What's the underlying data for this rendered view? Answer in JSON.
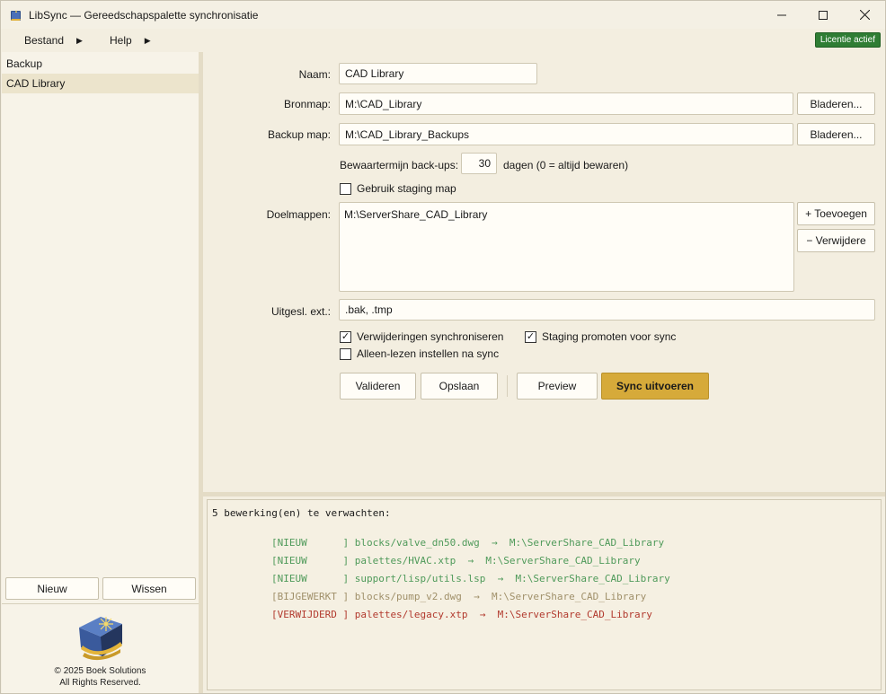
{
  "window": {
    "title": "LibSync — Gereedschapspalette synchronisatie",
    "controls": [
      "minimize",
      "maximize",
      "close"
    ]
  },
  "menu": {
    "items": [
      {
        "label": "Bestand"
      },
      {
        "label": "Help"
      }
    ],
    "license_badge": "Licentie actief"
  },
  "sidebar": {
    "items": [
      {
        "label": "Backup",
        "selected": false
      },
      {
        "label": "CAD Library",
        "selected": true
      }
    ],
    "new_button": "Nieuw",
    "clear_button": "Wissen",
    "copyright_line1": "© 2025 Boek Solutions",
    "copyright_line2": "All Rights Reserved."
  },
  "form": {
    "name_label": "Naam:",
    "name_value": "CAD Library",
    "source_label": "Bronmap:",
    "source_value": "M:\\CAD_Library",
    "source_browse": "Bladeren...",
    "backup_label": "Backup map:",
    "backup_value": "M:\\CAD_Library_Backups",
    "backup_browse": "Bladeren...",
    "retention_label": "Bewaartermijn back-ups:",
    "retention_value": "30",
    "retention_suffix": "dagen (0 = altijd bewaren)",
    "staging_label": "Gebruik staging map",
    "staging_checked": false,
    "targets_label": "Doelmappen:",
    "targets": [
      "M:\\ServerShare_CAD_Library"
    ],
    "add_button": "+ Toevoegen",
    "remove_button": "− Verwijdere",
    "excl_label": "Uitgesl. ext.:",
    "excl_value": ".bak, .tmp",
    "sync_deletes_label": "Verwijderingen synchroniseren",
    "sync_deletes_checked": true,
    "promote_staging_label": "Staging promoten voor sync",
    "promote_staging_checked": true,
    "readonly_label": "Alleen-lezen instellen na sync",
    "readonly_checked": false,
    "validate_button": "Valideren",
    "save_button": "Opslaan",
    "preview_button": "Preview",
    "sync_button": "Sync uitvoeren"
  },
  "log": {
    "header": "5 bewerking(en) te verwachten:",
    "lines": [
      {
        "tag": "[NIEUW      ]",
        "path": "blocks/valve_dn50.dwg",
        "arrow": "→",
        "target": "M:\\ServerShare_CAD_Library",
        "color": "#4f9a5a"
      },
      {
        "tag": "[NIEUW      ]",
        "path": "palettes/HVAC.xtp",
        "arrow": "→",
        "target": "M:\\ServerShare_CAD_Library",
        "color": "#4f9a5a"
      },
      {
        "tag": "[NIEUW      ]",
        "path": "support/lisp/utils.lsp",
        "arrow": "→",
        "target": "M:\\ServerShare_CAD_Library",
        "color": "#4f9a5a"
      },
      {
        "tag": "[BIJGEWERKT ]",
        "path": "blocks/pump_v2.dwg",
        "arrow": "→",
        "target": "M:\\ServerShare_CAD_Library",
        "color": "#a0906a"
      },
      {
        "tag": "[VERWIJDERD ]",
        "path": "palettes/legacy.xtp",
        "arrow": "→",
        "target": "M:\\ServerShare_CAD_Library",
        "color": "#b23a2e"
      }
    ]
  }
}
